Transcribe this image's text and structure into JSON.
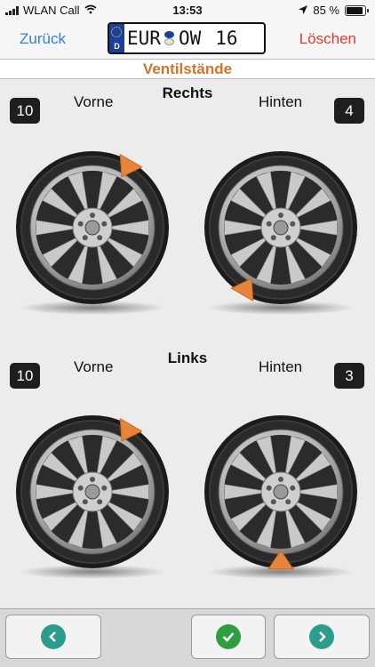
{
  "status": {
    "carrier": "WLAN Call",
    "time": "13:53",
    "battery": "85 %"
  },
  "nav": {
    "back_label": "Zurück",
    "delete_label": "Löschen",
    "plate": {
      "country": "D",
      "prefix": "EUR",
      "letters": "OW",
      "number": "16"
    }
  },
  "section_title": "Ventilstände",
  "right_axle": {
    "title": "Rechts",
    "front_label": "Vorne",
    "rear_label": "Hinten",
    "front_value": "10",
    "rear_value": "4"
  },
  "left_axle": {
    "title": "Links",
    "front_label": "Vorne",
    "rear_label": "Hinten",
    "front_value": "10",
    "rear_value": "3"
  },
  "colors": {
    "accent": "#d4742c",
    "back_blue": "#2f7fe6",
    "delete_red": "#e23a2b",
    "nav_teal": "#2a9d8f",
    "ok_green": "#2e9e3e"
  },
  "footer": {
    "prev_icon": "chevron-left-icon",
    "confirm_icon": "checkmark-icon",
    "next_icon": "chevron-right-icon"
  }
}
